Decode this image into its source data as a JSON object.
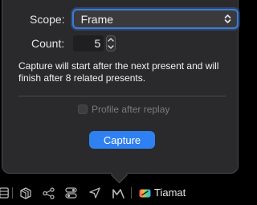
{
  "popover": {
    "scope_label": "Scope:",
    "scope_value": "Frame",
    "count_label": "Count:",
    "count_value": "5",
    "description": "Capture will start after the next present and will finish after 8 related presents.",
    "profile_label": "Profile after replay",
    "profile_checked": false,
    "capture_label": "Capture"
  },
  "toolbar": {
    "icons": [
      "list-icon",
      "cube-icon",
      "graph-icon",
      "toggle-icon",
      "location-arrow-icon",
      "metal-icon",
      "device-icon"
    ],
    "device_name": "Tiamat"
  },
  "colors": {
    "accent": "#2f80f0",
    "focus_ring": "#3d7bd6",
    "popover_bg": "#2a2a2c",
    "background": "#000000"
  }
}
